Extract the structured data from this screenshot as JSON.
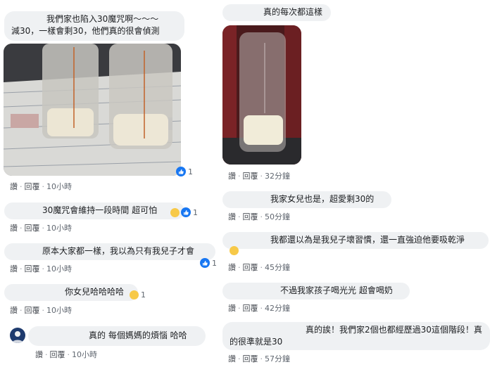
{
  "actions": {
    "like": "讚",
    "reply": "回覆",
    "sep": "·"
  },
  "left": [
    {
      "lines": [
        "我們家也陷入30魔咒啊～～～",
        "減30，一樣會剩30，他們真的很會偵測"
      ],
      "time": "10小時",
      "reactions": "1"
    },
    {
      "text": "30魔咒會維持一段時間 超可怕",
      "time": "10小時",
      "reactions": "1"
    },
    {
      "text": "原本大家都一樣，我以為只有我兒子才會",
      "time": "10小時",
      "reactions": "1"
    },
    {
      "text": "你女兒哈哈哈哈",
      "time": "10小時",
      "reactions": "1"
    },
    {
      "text": "真的 每個媽媽的煩惱 哈哈",
      "time": "10小時"
    }
  ],
  "right": [
    {
      "text": "真的每次都這樣",
      "time": "32分鐘"
    },
    {
      "text": "我家女兒也是，超愛剩30的",
      "time": "50分鐘"
    },
    {
      "text": "我都還以為是我兒子壞習慣，還一直強迫他要吸乾淨",
      "time": "45分鐘"
    },
    {
      "text": "不過我家孩子喝光光 超會喝奶",
      "time": "42分鐘"
    },
    {
      "lines": [
        "真的誒！我們家2個也都經歷過30這個階段！真",
        "的很準就是30"
      ],
      "time": "57分鐘"
    }
  ],
  "colors": {
    "bubble": "#eff1f3",
    "like_blue": "#1877f2",
    "meta": "#606770"
  }
}
